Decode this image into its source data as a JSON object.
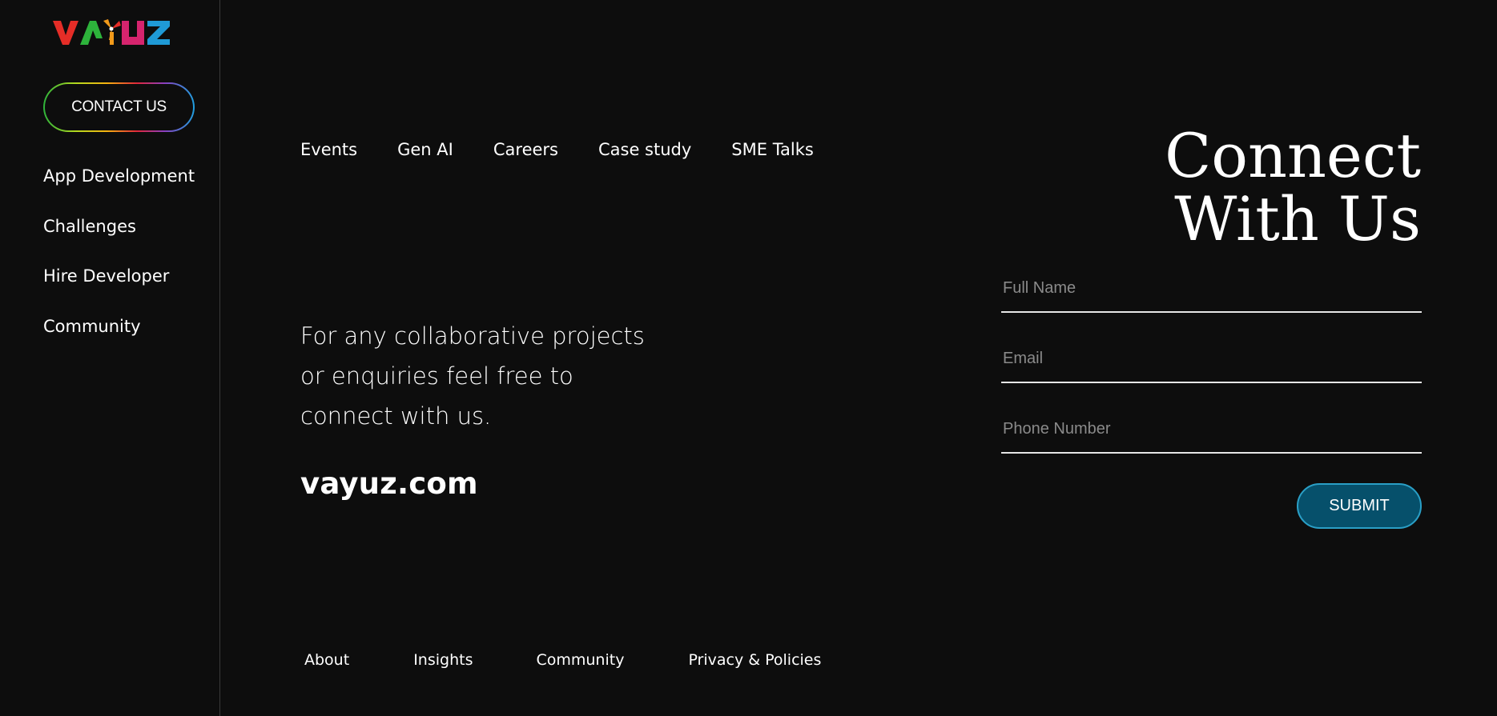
{
  "brand": {
    "logo_text": "VAYUZ",
    "logo_colors": [
      "#e52d27",
      "#2db33b",
      "#f29a1a",
      "#d6246e",
      "#1f9ad6"
    ]
  },
  "sidebar": {
    "contact_label": "CONTACT US",
    "items": [
      {
        "label": "App Development"
      },
      {
        "label": "Challenges"
      },
      {
        "label": "Hire Developer"
      },
      {
        "label": "Community"
      }
    ]
  },
  "top_nav": {
    "items": [
      {
        "label": "Events"
      },
      {
        "label": "Gen AI"
      },
      {
        "label": "Careers"
      },
      {
        "label": "Case study"
      },
      {
        "label": "SME Talks"
      }
    ]
  },
  "main": {
    "tagline": "For any collaborative projects or enquiries feel free to connect with us.",
    "site": "vayuz.com"
  },
  "form": {
    "title_line1": "Connect",
    "title_line2": "With Us",
    "full_name_placeholder": "Full Name",
    "email_placeholder": "Email",
    "phone_placeholder": "Phone Number",
    "submit_label": "SUBMIT"
  },
  "footer_nav": {
    "items": [
      {
        "label": "About"
      },
      {
        "label": "Insights"
      },
      {
        "label": "Community"
      },
      {
        "label": "Privacy & Policies"
      }
    ]
  },
  "colors": {
    "background": "#0d0d0d",
    "submit_bg": "#06506b",
    "submit_border": "#2a9fc6"
  }
}
